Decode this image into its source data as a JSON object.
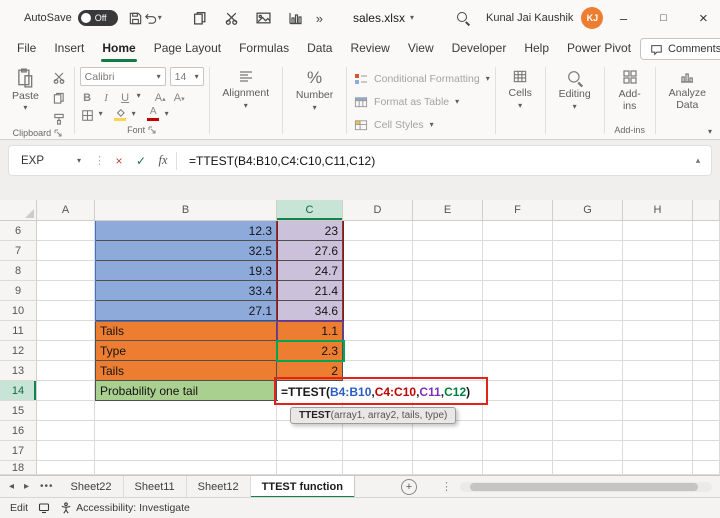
{
  "title_bar": {
    "autosave_label": "AutoSave",
    "autosave_state": "Off",
    "file_name": "sales.xlsx",
    "user_name": "Kunal Jai Kaushik",
    "user_initials": "KJ"
  },
  "icons": {
    "minimize": "–",
    "maximize": "□",
    "close": "×",
    "cancel": "×",
    "enter": "✓",
    "fx": "fx",
    "percent": "%",
    "more": "»",
    "dots": "•••",
    "nav_left": "◂",
    "nav_right": "▸",
    "grip": "⋮",
    "collapse": "▴",
    "add_sheet": "+"
  },
  "menu": {
    "tabs": [
      {
        "label": "File"
      },
      {
        "label": "Insert"
      },
      {
        "label": "Home",
        "active": true
      },
      {
        "label": "Page Layout"
      },
      {
        "label": "Formulas"
      },
      {
        "label": "Data"
      },
      {
        "label": "Review"
      },
      {
        "label": "View"
      },
      {
        "label": "Developer"
      },
      {
        "label": "Help"
      },
      {
        "label": "Power Pivot"
      }
    ],
    "comments_label": "Comments"
  },
  "ribbon": {
    "paste_label": "Paste",
    "clipboard_group": "Clipboard",
    "font_name": "Calibri",
    "font_size": "14",
    "bold": "B",
    "italic": "I",
    "underline": "U",
    "font_group": "Font",
    "alignment_label": "Alignment",
    "number_label": "Number",
    "styles": {
      "conditional_formatting": "Conditional Formatting",
      "format_as_table": "Format as Table",
      "cell_styles": "Cell Styles"
    },
    "cells_label": "Cells",
    "editing_label": "Editing",
    "addins_button": "Add-ins",
    "addins_group": "Add-ins",
    "analyze_data_label": "Analyze Data"
  },
  "formula_bar": {
    "name_box": "EXP",
    "formula": "=TTEST(B4:B10,C4:C10,C11,C12)"
  },
  "grid": {
    "columns": [
      "A",
      "B",
      "C",
      "D",
      "E",
      "F",
      "G",
      "H"
    ],
    "selected_column": "C",
    "selected_row": "14",
    "rows": [
      {
        "n": "6",
        "b": "12.3",
        "c": "23",
        "style": "data"
      },
      {
        "n": "7",
        "b": "32.5",
        "c": "27.6",
        "style": "data"
      },
      {
        "n": "8",
        "b": "19.3",
        "c": "24.7",
        "style": "data"
      },
      {
        "n": "9",
        "b": "33.4",
        "c": "21.4",
        "style": "data"
      },
      {
        "n": "10",
        "b": "27.1",
        "c": "34.6",
        "style": "data"
      },
      {
        "n": "11",
        "b": "Tails",
        "c": "1.1",
        "style": "param"
      },
      {
        "n": "12",
        "b": "Type",
        "c": "2.3",
        "style": "param"
      },
      {
        "n": "13",
        "b": "Tails",
        "c": "2",
        "style": "param"
      },
      {
        "n": "14",
        "b": "Probability one tail",
        "style": "result"
      },
      {
        "n": "15"
      },
      {
        "n": "16"
      },
      {
        "n": "17"
      },
      {
        "n": "18"
      }
    ],
    "formula_parts": [
      {
        "text": "=TTEST(",
        "color": "#1b1b1b"
      },
      {
        "text": "B4:B10",
        "color": "#2B5CC4"
      },
      {
        "text": ",",
        "color": "#1b1b1b"
      },
      {
        "text": "C4:C10",
        "color": "#C00000"
      },
      {
        "text": ",",
        "color": "#1b1b1b"
      },
      {
        "text": "C11",
        "color": "#7B2FBE"
      },
      {
        "text": ",",
        "color": "#1b1b1b"
      },
      {
        "text": "C12",
        "color": "#00823B"
      },
      {
        "text": ")",
        "color": "#1b1b1b"
      }
    ],
    "tooltip": {
      "function_name": "TTEST",
      "args": "(array1, array2, tails, type)"
    }
  },
  "colors": {
    "accent_green": "#107C41",
    "blue_fill": "#8EAADB",
    "purple_fill": "#CCC1DA",
    "orange_fill": "#ED7D31",
    "green_fill": "#A9D08E",
    "ref_blue": "#4472C4",
    "ref_red": "#C00000",
    "ref_purple": "#7B2FBE",
    "ref_green": "#00A651",
    "annotation_red": "#E2231A",
    "avatar_orange": "#ED7D31"
  },
  "sheet_tabs": {
    "tabs": [
      "Sheet22",
      "Sheet11",
      "Sheet12",
      "TTEST function"
    ],
    "active": "TTEST function"
  },
  "status_bar": {
    "mode": "Edit",
    "accessibility": "Accessibility: Investigate"
  }
}
